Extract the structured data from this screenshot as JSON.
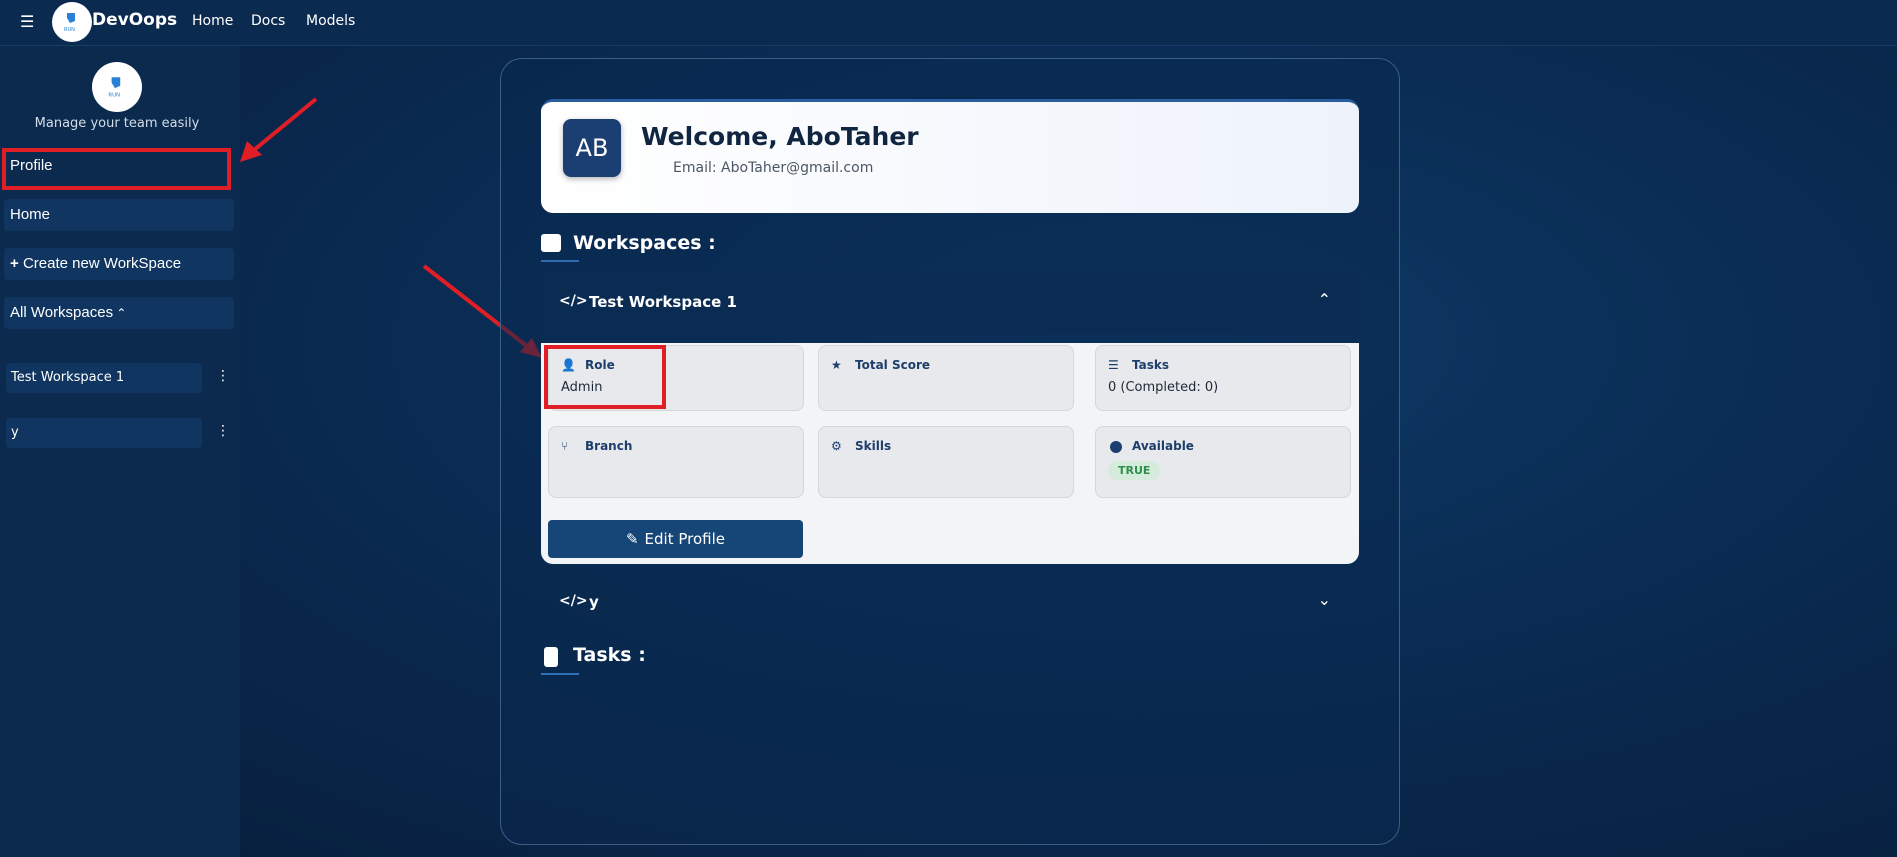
{
  "topbar": {
    "menu_icon": "hamburger-icon",
    "brand": "DevOops",
    "links": [
      "Home",
      "Docs",
      "Models"
    ]
  },
  "sidebar": {
    "tagline": "Manage your team easily",
    "items": [
      {
        "label": "Profile"
      },
      {
        "label": "Home"
      },
      {
        "label": "Create new WorkSpace",
        "icon": "plus-icon"
      },
      {
        "label": "All Workspaces",
        "icon": "chevron-up-icon"
      }
    ],
    "workspaces": [
      "Test Workspace 1",
      "y"
    ]
  },
  "profile": {
    "initials": "AB",
    "welcome": "Welcome, AboTaher",
    "email": "Email: AboTaher@gmail.com"
  },
  "workspaces_section": {
    "title": "Workspaces :",
    "items": [
      {
        "name": "Test Workspace 1",
        "expanded": true,
        "tiles": [
          {
            "label": "Role",
            "value": "Admin",
            "icon": "user-gear-icon"
          },
          {
            "label": "Total Score",
            "value": "",
            "icon": "star-icon"
          },
          {
            "label": "Tasks",
            "value": "0 (Completed: 0)",
            "icon": "list-check-icon"
          },
          {
            "label": "Branch",
            "value": "",
            "icon": "code-branch-icon"
          },
          {
            "label": "Skills",
            "value": "",
            "icon": "gears-icon"
          },
          {
            "label": "Available",
            "value": "TRUE",
            "icon": "circle-icon"
          }
        ],
        "edit_button": "Edit Profile"
      },
      {
        "name": "y",
        "expanded": false
      }
    ]
  },
  "tasks_section": {
    "title": "Tasks :"
  },
  "colors": {
    "accent": "#164677",
    "highlight": "#e01e26",
    "available": "#2f8f4a"
  }
}
